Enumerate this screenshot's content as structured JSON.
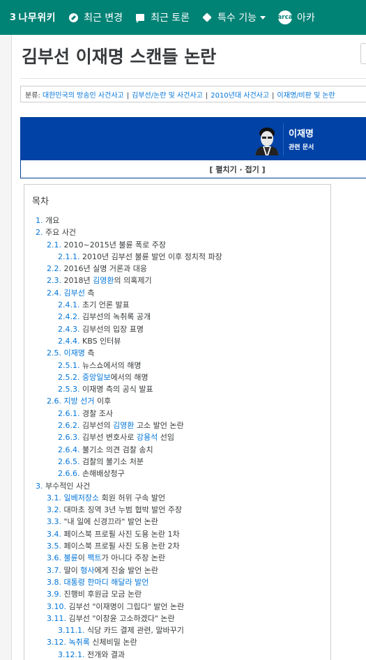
{
  "nav": {
    "logo": "나무위키",
    "items": [
      {
        "label": "최근 변경",
        "icon": "compass-icon"
      },
      {
        "label": "최근 토론",
        "icon": "comment-icon"
      },
      {
        "label": "특수 기능",
        "icon": "cube-icon"
      },
      {
        "label": "아카",
        "icon": "arca-icon"
      }
    ],
    "arca_badge": "arca"
  },
  "page": {
    "title": "김부선 이재명 스캔들 논란"
  },
  "categories": {
    "label": "분류:",
    "items": [
      "대한민국의 방송인 사건사고",
      "김부선/논란 및 사건사고",
      "2010년대 사건사고",
      "이재명/비판 및 논란"
    ]
  },
  "navbox": {
    "name": "이재명",
    "subtitle": "관련 문서",
    "toggle": "[ 펼치기 · 접기 ]"
  },
  "colors": {
    "nav": "#008275",
    "navbox": "#0042a6",
    "link": "#0275d8"
  },
  "toc": {
    "title": "목차",
    "items": [
      {
        "level": 1,
        "num": "1.",
        "parts": [
          {
            "t": "개요"
          }
        ]
      },
      {
        "level": 1,
        "num": "2.",
        "parts": [
          {
            "t": "주요 사건"
          }
        ]
      },
      {
        "level": 2,
        "num": "2.1.",
        "parts": [
          {
            "t": "2010~2015년 불륜 폭로 주장"
          }
        ]
      },
      {
        "level": 3,
        "num": "2.1.1.",
        "parts": [
          {
            "t": "2010년 김부선 불륜 발언 이후 정치적 파장"
          }
        ]
      },
      {
        "level": 2,
        "num": "2.2.",
        "parts": [
          {
            "t": "2016년 실명 거론과 대응"
          }
        ]
      },
      {
        "level": 2,
        "num": "2.3.",
        "parts": [
          {
            "t": "2018년 "
          },
          {
            "t": "김영환",
            "link": true
          },
          {
            "t": "의 의혹제기"
          }
        ]
      },
      {
        "level": 2,
        "num": "2.4.",
        "parts": [
          {
            "t": "김부선",
            "link": true
          },
          {
            "t": " 측"
          }
        ]
      },
      {
        "level": 3,
        "num": "2.4.1.",
        "parts": [
          {
            "t": "초기 언론 발표"
          }
        ]
      },
      {
        "level": 3,
        "num": "2.4.2.",
        "parts": [
          {
            "t": "김부선의 녹취록 공개"
          }
        ]
      },
      {
        "level": 3,
        "num": "2.4.3.",
        "parts": [
          {
            "t": "김부선의 입장 표명"
          }
        ]
      },
      {
        "level": 3,
        "num": "2.4.4.",
        "parts": [
          {
            "t": "KBS 인터뷰"
          }
        ]
      },
      {
        "level": 2,
        "num": "2.5.",
        "parts": [
          {
            "t": "이재명",
            "link": true
          },
          {
            "t": " 측"
          }
        ]
      },
      {
        "level": 3,
        "num": "2.5.1.",
        "parts": [
          {
            "t": "뉴스쇼에서의 해명"
          }
        ]
      },
      {
        "level": 3,
        "num": "2.5.2.",
        "parts": [
          {
            "t": "중앙일보",
            "link": true
          },
          {
            "t": "에서의 해명"
          }
        ]
      },
      {
        "level": 3,
        "num": "2.5.3.",
        "parts": [
          {
            "t": "이재명 측의 공식 발표"
          }
        ]
      },
      {
        "level": 2,
        "num": "2.6.",
        "parts": [
          {
            "t": "지방 선거",
            "link": true
          },
          {
            "t": " 이후"
          }
        ]
      },
      {
        "level": 3,
        "num": "2.6.1.",
        "parts": [
          {
            "t": "경찰 조사"
          }
        ]
      },
      {
        "level": 3,
        "num": "2.6.2.",
        "parts": [
          {
            "t": "김부선의 "
          },
          {
            "t": "김영환",
            "link": true
          },
          {
            "t": " 고소 발언 논란"
          }
        ]
      },
      {
        "level": 3,
        "num": "2.6.3.",
        "parts": [
          {
            "t": "김부선 변호사로 "
          },
          {
            "t": "강용석",
            "link": true
          },
          {
            "t": " 선임"
          }
        ]
      },
      {
        "level": 3,
        "num": "2.6.4.",
        "parts": [
          {
            "t": "불기소 의견 검찰 송치"
          }
        ]
      },
      {
        "level": 3,
        "num": "2.6.5.",
        "parts": [
          {
            "t": "검찰의 불기소 처분"
          }
        ]
      },
      {
        "level": 3,
        "num": "2.6.6.",
        "parts": [
          {
            "t": "손해배상청구"
          }
        ]
      },
      {
        "level": 1,
        "num": "3.",
        "parts": [
          {
            "t": "부수적인 사건"
          }
        ]
      },
      {
        "level": 2,
        "num": "3.1.",
        "parts": [
          {
            "t": "일베저장소",
            "link": true
          },
          {
            "t": " 회원 허위 구속 발언"
          }
        ]
      },
      {
        "level": 2,
        "num": "3.2.",
        "parts": [
          {
            "t": "대마초 징역 3년 누범 협박 발언 주장"
          }
        ]
      },
      {
        "level": 2,
        "num": "3.3.",
        "parts": [
          {
            "t": "\"내 일에 신경끄라\" 발언 논란"
          }
        ]
      },
      {
        "level": 2,
        "num": "3.4.",
        "parts": [
          {
            "t": "페이스북 프로필 사진 도용 논란 1차"
          }
        ]
      },
      {
        "level": 2,
        "num": "3.5.",
        "parts": [
          {
            "t": "페이스북 프로필 사진 도용 논란 2차"
          }
        ]
      },
      {
        "level": 2,
        "num": "3.6.",
        "parts": [
          {
            "t": "불륜",
            "link": true
          },
          {
            "t": "이 "
          },
          {
            "t": "팩트",
            "link": true
          },
          {
            "t": "가 아니다 주장 논란"
          }
        ]
      },
      {
        "level": 2,
        "num": "3.7.",
        "parts": [
          {
            "t": "딸이 "
          },
          {
            "t": "형사",
            "link": true
          },
          {
            "t": "에게 진술 발언 논란"
          }
        ]
      },
      {
        "level": 2,
        "num": "3.8.",
        "parts": [
          {
            "t": "대통령 한마디 해달라 발언",
            "link": true
          }
        ]
      },
      {
        "level": 2,
        "num": "3.9.",
        "parts": [
          {
            "t": "진행비 후원금 모금 논란"
          }
        ]
      },
      {
        "level": 2,
        "num": "3.10.",
        "parts": [
          {
            "t": "김부선 \"이재명이 그립다\" 발언 논란"
          }
        ]
      },
      {
        "level": 2,
        "num": "3.11.",
        "parts": [
          {
            "t": "김부선 \"이창윤 고소하겠다\" 논란"
          }
        ]
      },
      {
        "level": 3,
        "num": "3.11.1.",
        "parts": [
          {
            "t": "식당 카드 결제 관련, 말바꾸기"
          }
        ]
      },
      {
        "level": 2,
        "num": "3.12.",
        "parts": [
          {
            "t": "녹취록",
            "link": true
          },
          {
            "t": " 신체비밀 논란"
          }
        ]
      },
      {
        "level": 3,
        "num": "3.12.1.",
        "parts": [
          {
            "t": "전개와 결과"
          }
        ]
      }
    ]
  }
}
